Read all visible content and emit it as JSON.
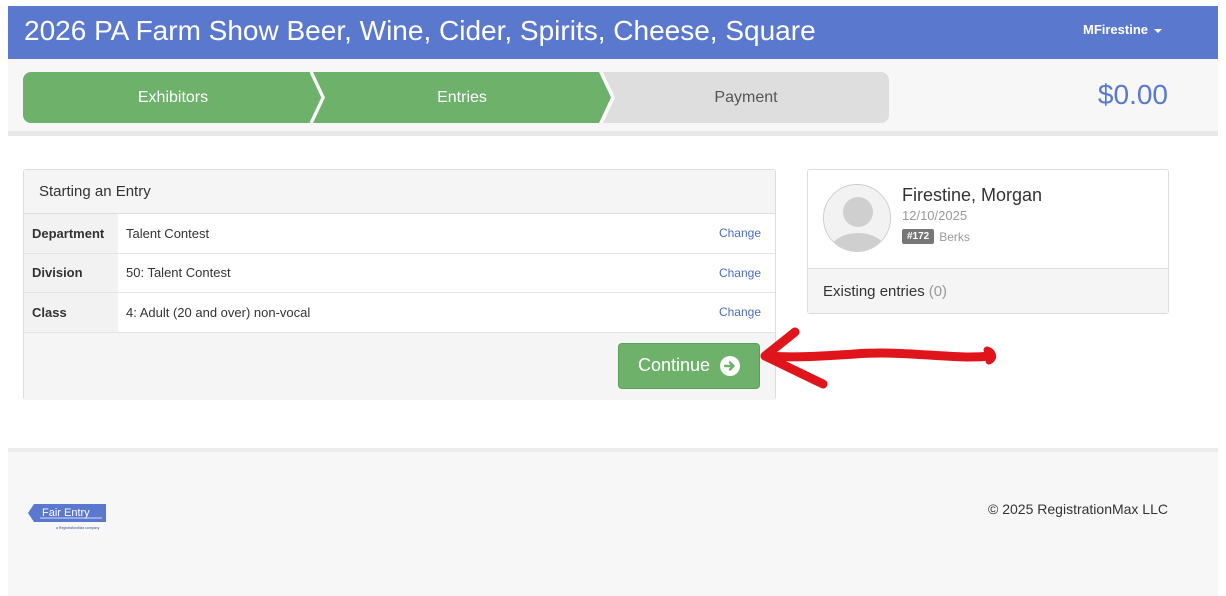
{
  "header": {
    "title": "2026 PA Farm Show Beer, Wine, Cider, Spirits, Cheese, Square",
    "user": "MFirestine"
  },
  "steps": [
    {
      "label": "Exhibitors",
      "state": "complete"
    },
    {
      "label": "Entries",
      "state": "active"
    },
    {
      "label": "Payment",
      "state": "pending"
    }
  ],
  "cart_total": "$0.00",
  "entry": {
    "heading": "Starting an Entry",
    "rows": [
      {
        "label": "Department",
        "value": "Talent Contest",
        "action": "Change"
      },
      {
        "label": "Division",
        "value": "50: Talent Contest",
        "action": "Change"
      },
      {
        "label": "Class",
        "value": "4: Adult (20 and over) non-vocal",
        "action": "Change"
      }
    ],
    "continue_label": "Continue"
  },
  "exhibitor": {
    "name": "Firestine, Morgan",
    "date": "12/10/2025",
    "id_badge": "#172",
    "county": "Berks",
    "existing_label": "Existing entries",
    "existing_count": "(0)"
  },
  "footer": {
    "copyright": "© 2025 RegistrationMax LLC",
    "logo_text": "Fair Entry",
    "logo_subtext": "a RegistrationMax company"
  },
  "colors": {
    "header_bg": "#5b78cf",
    "step_complete": "#6db16b",
    "step_pending": "#dedede",
    "link": "#4a6cc7",
    "annotation": "#e0151b"
  }
}
